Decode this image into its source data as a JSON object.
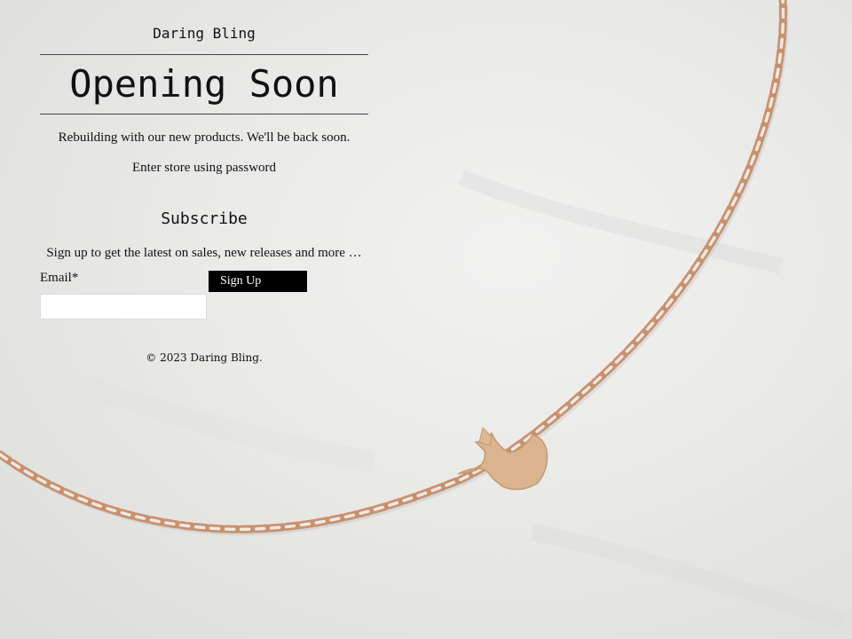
{
  "brand": "Daring Bling",
  "page_title": "Opening Soon",
  "tagline": "Rebuilding with our new products. We'll be back soon.",
  "password_link": "Enter store using password",
  "subscribe": {
    "heading": "Subscribe",
    "description": "Sign up to get the latest on sales, new releases and more …",
    "email_label": "Email*",
    "email_value": "",
    "button_label": "Sign Up"
  },
  "footer": "© 2023 Daring Bling.",
  "background": {
    "image": "necklace-photo",
    "colors": {
      "marble": "#e8e8e6",
      "chain": "#cf9e7c",
      "pendant": "#d9b48f"
    }
  }
}
